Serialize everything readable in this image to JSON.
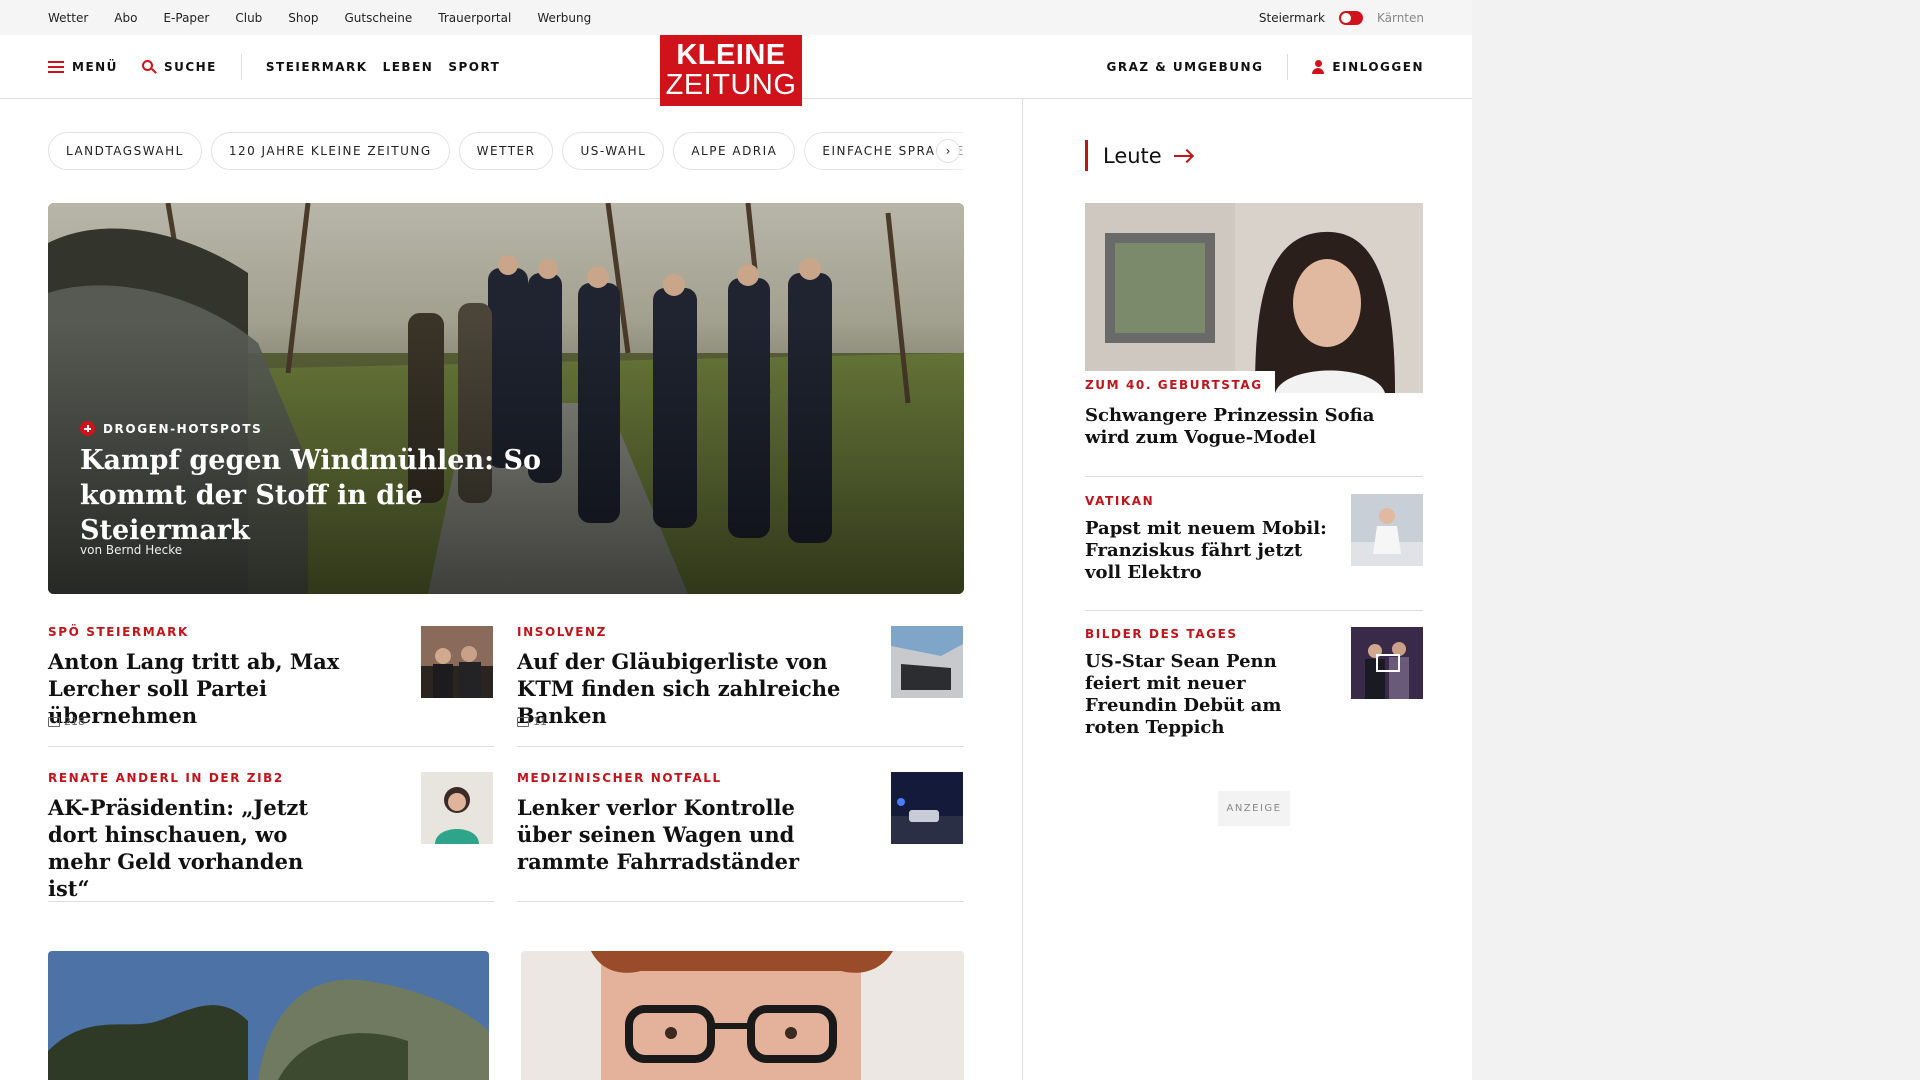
{
  "util": {
    "links": [
      "Wetter",
      "Abo",
      "E-Paper",
      "Club",
      "Shop",
      "Gutscheine",
      "Trauerportal",
      "Werbung"
    ],
    "region_active": "Steiermark",
    "region_other": "Kärnten"
  },
  "header": {
    "menu": "MENÜ",
    "search": "SUCHE",
    "nav": [
      "STEIERMARK",
      "LEBEN",
      "SPORT"
    ],
    "logo_line1": "KLEINE",
    "logo_line2": "ZEITUNG",
    "local": "GRAZ & UMGEBUNG",
    "login": "EINLOGGEN"
  },
  "tags": [
    "LANDTAGSWAHL",
    "120 JAHRE KLEINE ZEITUNG",
    "WETTER",
    "US-WAHL",
    "ALPE ADRIA",
    "EINFACHE SPRACHE"
  ],
  "hero": {
    "kicker": "DROGEN-HOTSPOTS",
    "title": "Kampf gegen Windmühlen: So kommt der Stoff in die Steiermark",
    "byline": "von Bernd Hecke"
  },
  "teasers": [
    {
      "kicker": "SPÖ STEIERMARK",
      "title": "Anton Lang tritt ab, Max Lercher soll Partei übernehmen",
      "comments": "218"
    },
    {
      "kicker": "INSOLVENZ",
      "title": "Auf der Gläubigerliste von KTM finden sich zahlreiche Banken",
      "comments": "11"
    },
    {
      "kicker": "RENATE ANDERL IN DER ZIB2",
      "title": "AK-Präsidentin: „Jetzt dort hinschauen, wo mehr Geld vorhanden ist“"
    },
    {
      "kicker": "MEDIZINISCHER NOTFALL",
      "title": "Lenker verlor Kontrolle über seinen Wagen und rammte Fahrradständer"
    }
  ],
  "right": {
    "section": "Leute",
    "main": {
      "kicker": "ZUM 40. GEBURTSTAG",
      "title": "Schwangere Prinzessin Sofia wird zum Vogue-Model"
    },
    "items": [
      {
        "kicker": "VATIKAN",
        "title": "Papst mit neuem Mobil: Franziskus fährt jetzt voll Elektro"
      },
      {
        "kicker": "BILDER DES TAGES",
        "title": "US-Star Sean Penn feiert mit neuer Freundin Debüt am roten Teppich"
      }
    ],
    "ad": "ANZEIGE"
  },
  "colors": {
    "brand": "#d0121a",
    "kicker": "#c0141a"
  }
}
